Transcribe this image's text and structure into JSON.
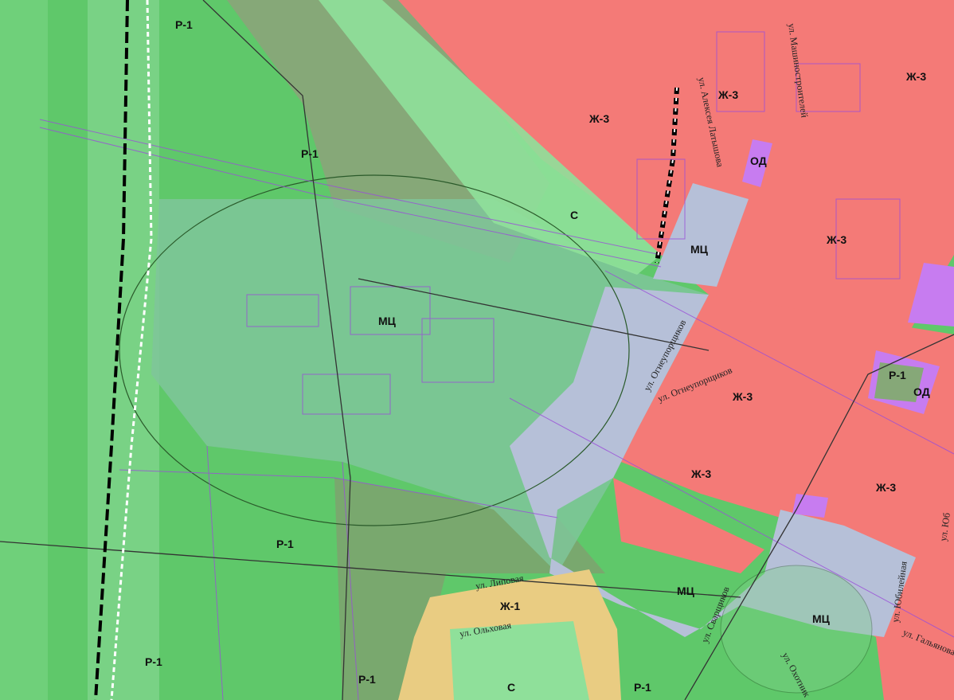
{
  "map": {
    "zone_colors": {
      "R-1": "#5fc86a",
      "R-1_dark": "#86a878",
      "Zh-3": "#f47a77",
      "MTs": "#b6c0d8",
      "OD": "#c77cf0",
      "Zh-1": "#e9cc82",
      "S": "#8fe09a",
      "parcel_line": "#9a4fd8"
    },
    "zone_labels": [
      "Р-1",
      "Р-1",
      "Ж-3",
      "Ж-3",
      "Ж-3",
      "ОД",
      "С",
      "МЦ",
      "Ж-3",
      "МЦ",
      "Р-1",
      "ОД",
      "Ж-3",
      "Ж-3",
      "Ж-3",
      "Р-1",
      "МЦ",
      "Ж-1",
      "МЦ",
      "Р-1",
      "Р-1",
      "С",
      "Р-1"
    ],
    "street_labels": [
      "ул. Машиностроителей",
      "ул. Алексея Латышова",
      "ул. Огнеупорщиков",
      "ул. Огнеупорщиков",
      "ул. Липовая",
      "ул. Ольховая",
      "ул. Сварщиков",
      "ул. Охотник",
      "ул. Юбилейная",
      "ул. Гальянова",
      "ул. Юб"
    ]
  }
}
